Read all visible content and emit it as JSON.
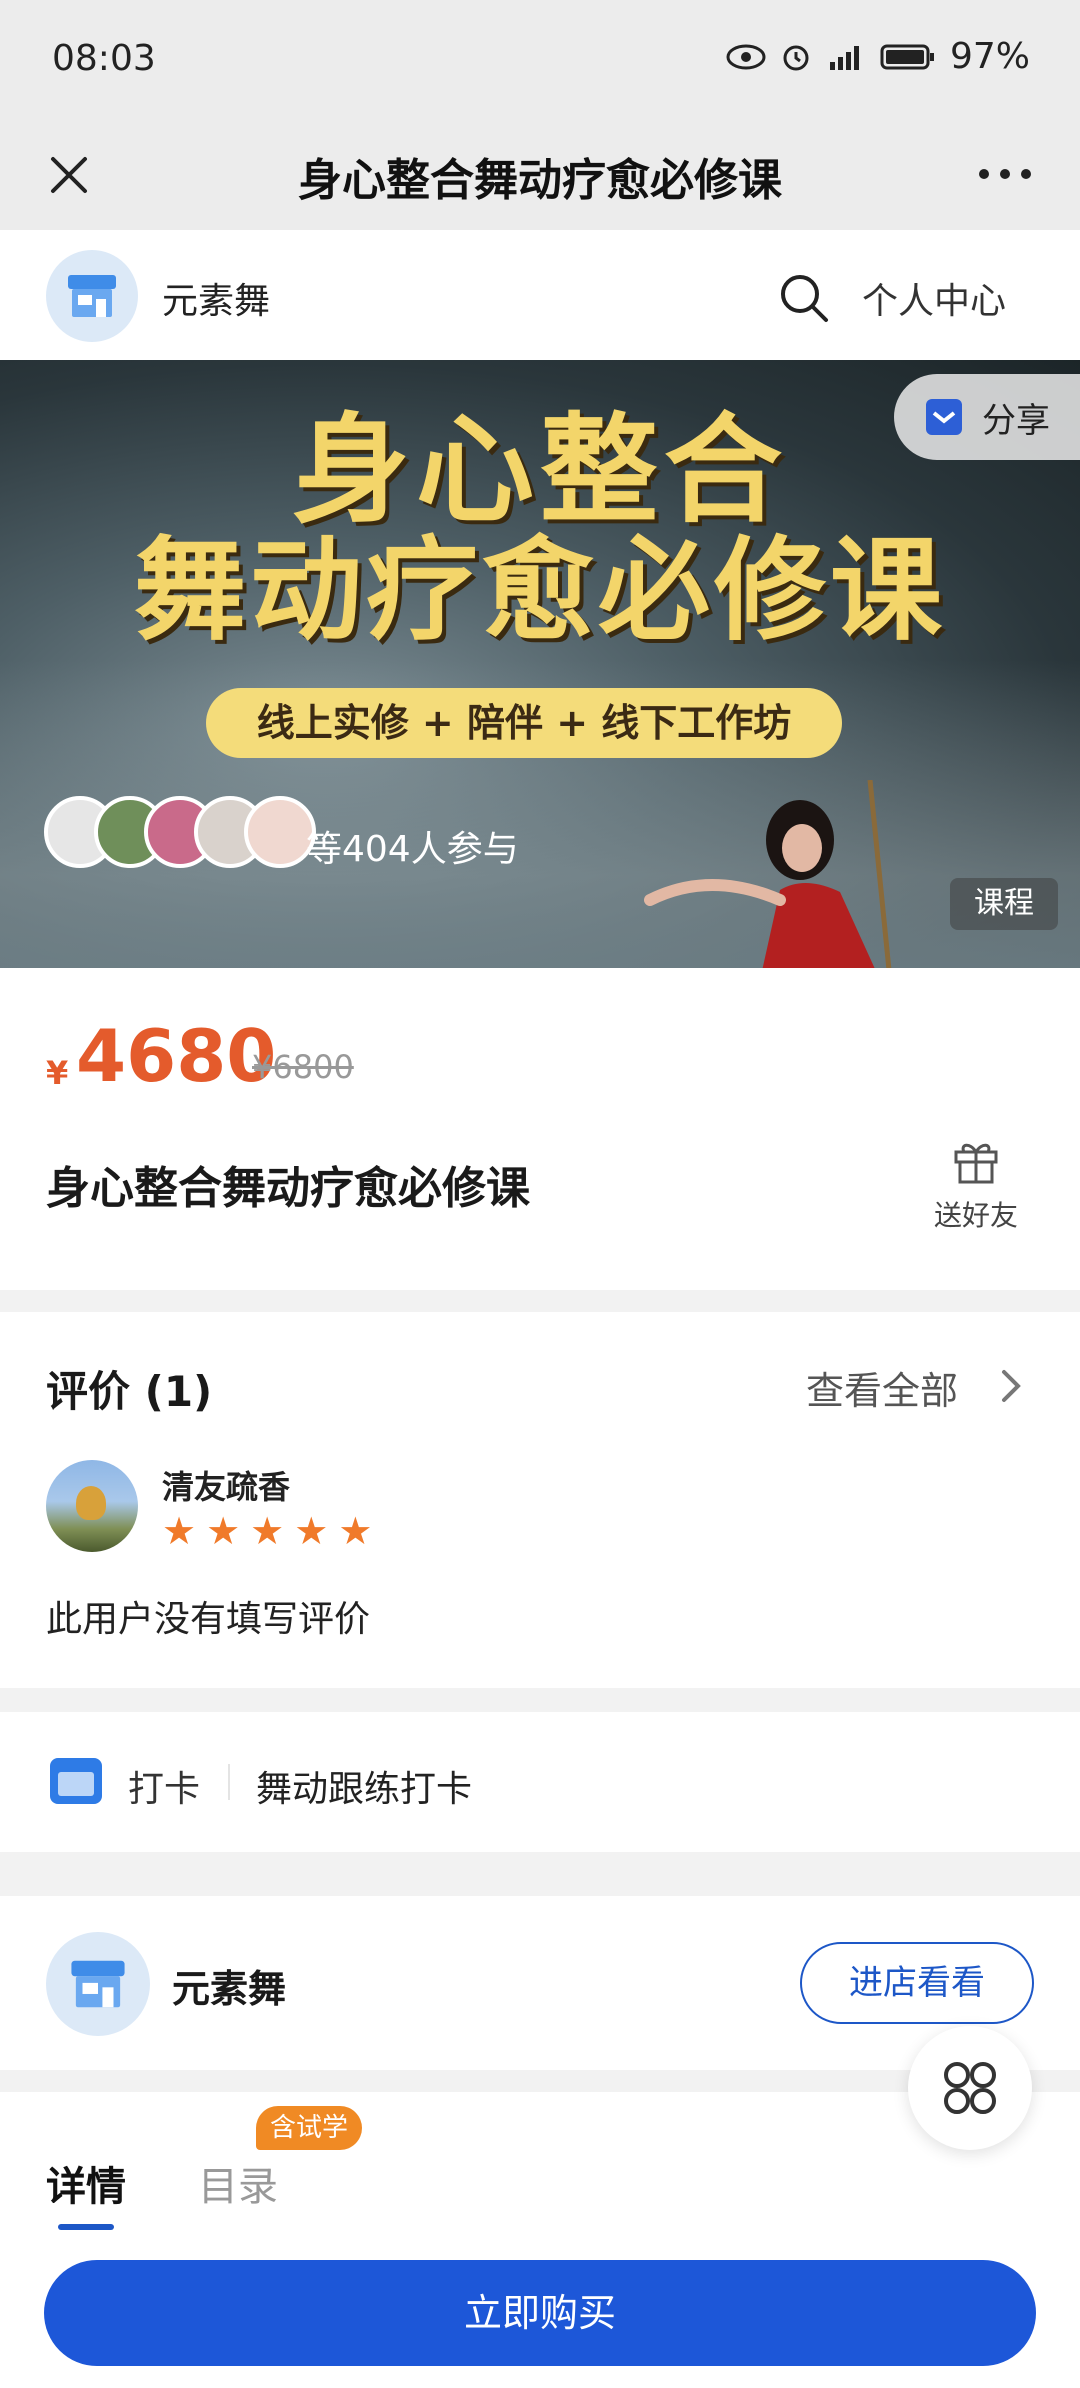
{
  "status_bar": {
    "time": "08:03",
    "battery": "97%"
  },
  "nav": {
    "title": "身心整合舞动疗愈必修课"
  },
  "shop_header": {
    "name": "元素舞",
    "personal_center": "个人中心"
  },
  "banner": {
    "headline_line1": "身心整合",
    "headline_line2": "舞动疗愈必修课",
    "subtitle": "线上实修 + 陪伴 + 线下工作坊",
    "share_label": "分享",
    "participants": "等404人参与",
    "tag": "课程"
  },
  "price": {
    "currency": "¥",
    "current": "4680",
    "original": "¥6800"
  },
  "course": {
    "title": "身心整合舞动疗愈必修课",
    "gift_label": "送好友"
  },
  "reviews": {
    "title": "评价 (1)",
    "view_all": "查看全部",
    "items": [
      {
        "user": "清友疏香",
        "rating": 5,
        "content": "此用户没有填写评价"
      }
    ]
  },
  "checkin": {
    "label": "打卡",
    "value": "舞动跟练打卡"
  },
  "shop_card": {
    "name": "元素舞",
    "button": "进店看看"
  },
  "tabs": {
    "detail": "详情",
    "catalog": "目录",
    "badge": "含试学"
  },
  "buy": {
    "button": "立即购买"
  },
  "colors": {
    "accent": "#1d57d8",
    "price": "#e45b2c",
    "banner_gold": "#f3d56a",
    "badge": "#f08a24"
  }
}
